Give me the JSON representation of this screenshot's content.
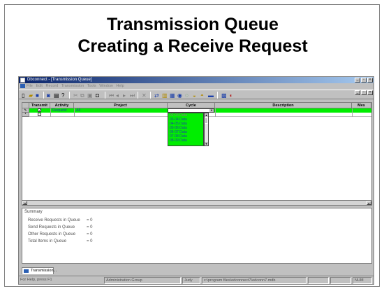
{
  "slide": {
    "title_line1": "Transmission Queue",
    "title_line2": "Creating a Receive Request"
  },
  "window": {
    "title": "Dbconnect - [Transmission Queue]",
    "menu": [
      "File",
      "Edit",
      "Record",
      "Transmission",
      "Tools",
      "Window",
      "Help"
    ],
    "controls": [
      "_",
      "▫",
      "×"
    ]
  },
  "grid": {
    "columns": [
      "Transmit",
      "Activity",
      "Project",
      "Cycle",
      "Description",
      "Mes"
    ],
    "rows": [
      {
        "marker": "✎",
        "transmit": "✓",
        "activity": "Request",
        "project": "All",
        "cycle": ""
      },
      {
        "marker": "*",
        "transmit": "",
        "activity": "",
        "project": "",
        "cycle": ""
      }
    ],
    "cycle_options": [
      "02-03 Data",
      "03-04 Data",
      "04-05 Data",
      "05-06 Data",
      "06-07 Data",
      "07-08 Data",
      "08-09 Data"
    ]
  },
  "summary": {
    "label": "Summary",
    "lines": [
      {
        "label": "Receive Requests in Queue",
        "value": "= 0"
      },
      {
        "label": "Send Requests in Queue",
        "value": "= 0"
      },
      {
        "label": "Other Requests in Queue",
        "value": "= 0"
      },
      {
        "label": "Total Items in Queue",
        "value": "= 0"
      }
    ]
  },
  "tabs": [
    "Transmission..."
  ],
  "statusbar": {
    "help": "For Help, press F1",
    "group": "Administration Group",
    "user": "Judy",
    "path": "c:\\program files\\edconnect7\\edconn7.mdb",
    "mode": "NUM"
  }
}
